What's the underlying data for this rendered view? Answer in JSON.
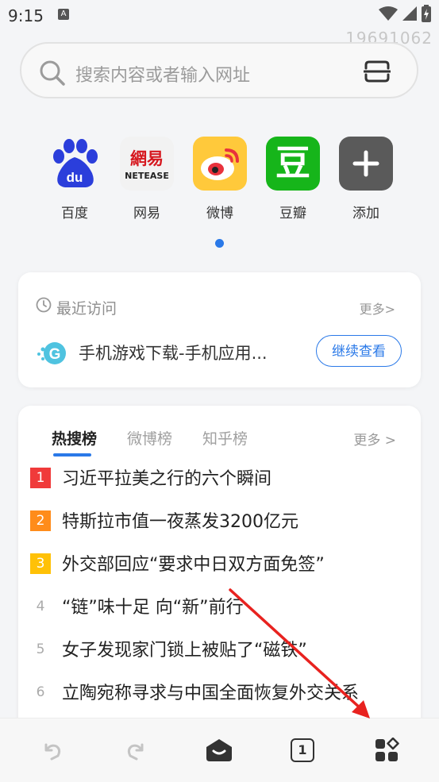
{
  "status_bar": {
    "time": "9:15",
    "notif_glyph": "A"
  },
  "watermark": "19691062",
  "search": {
    "placeholder": "搜索内容或者输入网址"
  },
  "shortcuts": [
    {
      "label": "百度",
      "icon": "baidu-paw-icon",
      "color": "#2b3edb"
    },
    {
      "label": "网易",
      "icon": "netease-icon",
      "logo_cn": "網易",
      "logo_en": "NETEASE",
      "color": "#d6181f"
    },
    {
      "label": "微博",
      "icon": "weibo-icon",
      "color": "#ffc93b"
    },
    {
      "label": "豆瓣",
      "icon": "douban-icon",
      "logo": "豆",
      "color": "#16b51a"
    },
    {
      "label": "添加",
      "icon": "add-icon",
      "color": "#555555"
    }
  ],
  "recent": {
    "title": "最近访问",
    "more": "更多>",
    "item": {
      "title": "手机游戏下载-手机应用...",
      "icon": "g-site-icon"
    },
    "continue_label": "继续查看"
  },
  "hot": {
    "tabs": [
      "热搜榜",
      "微博榜",
      "知乎榜"
    ],
    "active_tab": "热搜榜",
    "more": "更多 >",
    "items": [
      {
        "rank": "1",
        "text": "习近平拉美之行的六个瞬间",
        "badge_color": "#f03a3a"
      },
      {
        "rank": "2",
        "text": "特斯拉市值一夜蒸发3200亿元",
        "badge_color": "#ff8c1a"
      },
      {
        "rank": "3",
        "text": "外交部回应“要求中日双方面免签”",
        "badge_color": "#ffc107"
      },
      {
        "rank": "4",
        "text": "“链”味十足 向“新”前行",
        "badge_color": ""
      },
      {
        "rank": "5",
        "text": "女子发现家门锁上被贴了“磁铁”",
        "badge_color": ""
      },
      {
        "rank": "6",
        "text": "立陶宛称寻求与中国全面恢复外交关系",
        "badge_color": ""
      }
    ]
  },
  "bottom_nav": {
    "back": "back-icon",
    "forward": "forward-icon",
    "home": "home-icon",
    "tabs_count": "1",
    "menu": "apps-grid-icon"
  },
  "accent_color": "#2a79e8"
}
